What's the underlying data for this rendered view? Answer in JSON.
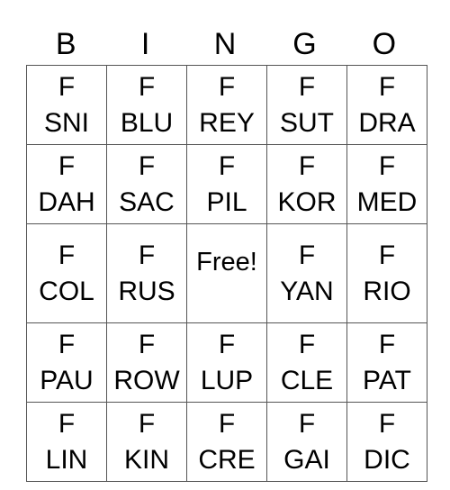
{
  "header": [
    "B",
    "I",
    "N",
    "G",
    "O"
  ],
  "rows": [
    [
      [
        "F",
        "SNI"
      ],
      [
        "F",
        "BLU"
      ],
      [
        "F",
        "REY"
      ],
      [
        "F",
        "SUT"
      ],
      [
        "F",
        "DRA"
      ]
    ],
    [
      [
        "F",
        "DAH"
      ],
      [
        "F",
        "SAC"
      ],
      [
        "F",
        "PIL"
      ],
      [
        "F",
        "KOR"
      ],
      [
        "F",
        "MED"
      ]
    ],
    [
      [
        "F",
        "COL"
      ],
      [
        "F",
        "RUS"
      ],
      [
        "Free!"
      ],
      [
        "F",
        "YAN"
      ],
      [
        "F",
        "RIO"
      ]
    ],
    [
      [
        "F",
        "PAU"
      ],
      [
        "F",
        "ROW"
      ],
      [
        "F",
        "LUP"
      ],
      [
        "F",
        "CLE"
      ],
      [
        "F",
        "PAT"
      ]
    ],
    [
      [
        "F",
        "LIN"
      ],
      [
        "F",
        "KIN"
      ],
      [
        "F",
        "CRE"
      ],
      [
        "F",
        "GAI"
      ],
      [
        "F",
        "DIC"
      ]
    ]
  ]
}
